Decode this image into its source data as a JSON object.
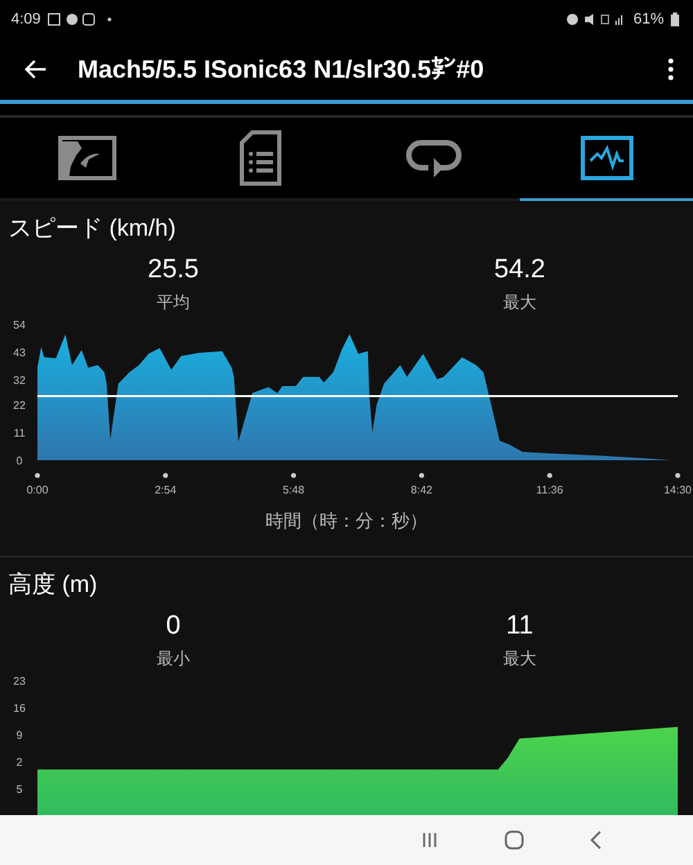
{
  "status_bar": {
    "time": "4:09",
    "battery": "61%"
  },
  "app_bar": {
    "title": "Mach5/5.5 ISonic63 N1/slr30.5㌢#0"
  },
  "tabs": [
    {
      "kind": "map",
      "selected": false
    },
    {
      "kind": "details",
      "selected": false
    },
    {
      "kind": "laps",
      "selected": false
    },
    {
      "kind": "graphs",
      "selected": true
    }
  ],
  "sections": [
    {
      "title": "スピード (km/h)",
      "stats": [
        {
          "value": "25.5",
          "label": "平均"
        },
        {
          "value": "54.2",
          "label": "最大"
        }
      ],
      "chart_data": {
        "type": "area",
        "xlabel": "時間（時：分：秒）",
        "xlim": [
          0,
          870
        ],
        "ylim": [
          0,
          54
        ],
        "yticks": [
          0,
          11,
          22,
          32,
          43,
          54
        ],
        "xticks": [
          {
            "value": 0,
            "label": "0:00"
          },
          {
            "value": 174,
            "label": "2:54"
          },
          {
            "value": 348,
            "label": "5:48"
          },
          {
            "value": 522,
            "label": "8:42"
          },
          {
            "value": 696,
            "label": "11:36"
          },
          {
            "value": 870,
            "label": "14:30"
          }
        ],
        "x": [
          0,
          5,
          9,
          25,
          38,
          47,
          60,
          69,
          82,
          91,
          94,
          99,
          110,
          125,
          138,
          151,
          166,
          182,
          195,
          220,
          251,
          264,
          267,
          273,
          292,
          314,
          326,
          333,
          351,
          361,
          383,
          389,
          402,
          414,
          424,
          436,
          449,
          451,
          455,
          461,
          471,
          493,
          502,
          524,
          543,
          552,
          577,
          596,
          606,
          615,
          628,
          640,
          659,
          703,
          766,
          829,
          860
        ],
        "series": [
          {
            "color": "#1ab0e0",
            "values": [
              36.8,
              45,
              41,
              40.5,
              50,
              37.8,
              43.8,
              36.8,
              37.8,
              35,
              30.4,
              8.3,
              30.4,
              35,
              37.8,
              42.3,
              44.6,
              35.9,
              41.4,
              42.7,
              43.3,
              36.8,
              33.1,
              7.4,
              26.7,
              29.1,
              26.7,
              29.5,
              29.5,
              33.1,
              33.1,
              30.9,
              35,
              44.2,
              50.1,
              42.3,
              43.3,
              25.8,
              11,
              22.1,
              30.4,
              37.8,
              33.1,
              42.3,
              32.2,
              33.1,
              40.9,
              37.8,
              35,
              23.9,
              7.7,
              6.4,
              3.3,
              2.6,
              1.8,
              0.7,
              0
            ]
          }
        ],
        "ref_lines": [
          {
            "axis": "y",
            "value": 25.5
          }
        ]
      }
    },
    {
      "title": "高度 (m)",
      "stats": [
        {
          "value": "0",
          "label": "最小"
        },
        {
          "value": "11",
          "label": "最大"
        }
      ],
      "chart_data": {
        "type": "area",
        "xlim": [
          0,
          870
        ],
        "ylim": [
          -5,
          23
        ],
        "yticks": [
          {
            "value": -5,
            "label": "5"
          },
          2,
          9,
          16,
          23
        ],
        "x": [
          0,
          626,
          639,
          655,
          870
        ],
        "series": [
          {
            "color": "#4cd44c",
            "values": [
              0,
              0,
              3,
              8,
              11
            ]
          }
        ]
      }
    }
  ]
}
